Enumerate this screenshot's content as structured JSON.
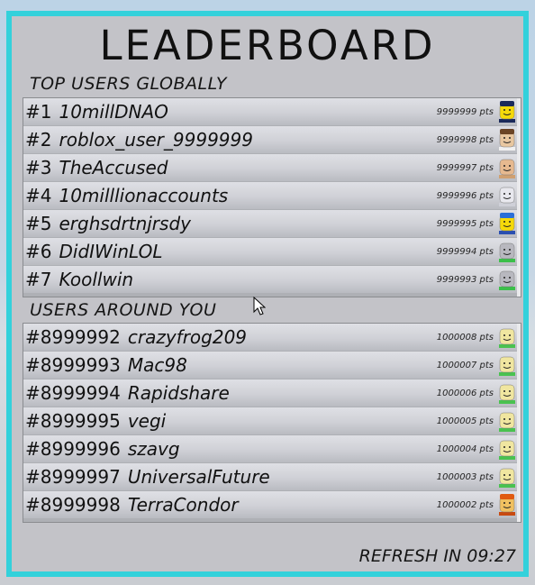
{
  "title": "LEADERBOARD",
  "top_section": {
    "title": "TOP USERS GLOBALLY",
    "rows": [
      {
        "rank": "#1",
        "name": "10millDNAO",
        "points": "9999999 pts",
        "avatar": "police-avatar-icon"
      },
      {
        "rank": "#2",
        "name": "roblox_user_9999999",
        "points": "9999998 pts",
        "avatar": "cowboy-avatar-icon"
      },
      {
        "rank": "#3",
        "name": "TheAccused",
        "points": "9999997 pts",
        "avatar": "tan-face-avatar-icon"
      },
      {
        "rank": "#4",
        "name": "10milllionaccounts",
        "points": "9999996 pts",
        "avatar": "white-face-avatar-icon"
      },
      {
        "rank": "#5",
        "name": "erghsdrtnjrsdy",
        "points": "9999995 pts",
        "avatar": "blue-hat-avatar-icon"
      },
      {
        "rank": "#6",
        "name": "DidIWinLOL",
        "points": "9999994 pts",
        "avatar": "gray-face-avatar-icon"
      },
      {
        "rank": "#7",
        "name": "Koollwin",
        "points": "9999993 pts",
        "avatar": "gray-face-avatar-icon"
      }
    ]
  },
  "around_section": {
    "title": "USERS AROUND YOU",
    "rows": [
      {
        "rank": "#8999992",
        "name": "crazyfrog209",
        "points": "1000008 pts",
        "avatar": "yellow-face-avatar-icon"
      },
      {
        "rank": "#8999993",
        "name": "Mac98",
        "points": "1000007 pts",
        "avatar": "yellow-face-avatar-icon"
      },
      {
        "rank": "#8999994",
        "name": "Rapidshare",
        "points": "1000006 pts",
        "avatar": "yellow-face-avatar-icon"
      },
      {
        "rank": "#8999995",
        "name": "vegi",
        "points": "1000005 pts",
        "avatar": "yellow-face-avatar-icon"
      },
      {
        "rank": "#8999996",
        "name": "szavg",
        "points": "1000004 pts",
        "avatar": "yellow-face-avatar-icon"
      },
      {
        "rank": "#8999997",
        "name": "UniversalFuture",
        "points": "1000003 pts",
        "avatar": "yellow-face-avatar-icon"
      },
      {
        "rank": "#8999998",
        "name": "TerraCondor",
        "points": "1000002 pts",
        "avatar": "orange-hair-avatar-icon"
      }
    ]
  },
  "refresh_text": "REFRESH IN 09:27",
  "colors": {
    "frame": "#33d1db",
    "panel": "#c3c3c8"
  }
}
